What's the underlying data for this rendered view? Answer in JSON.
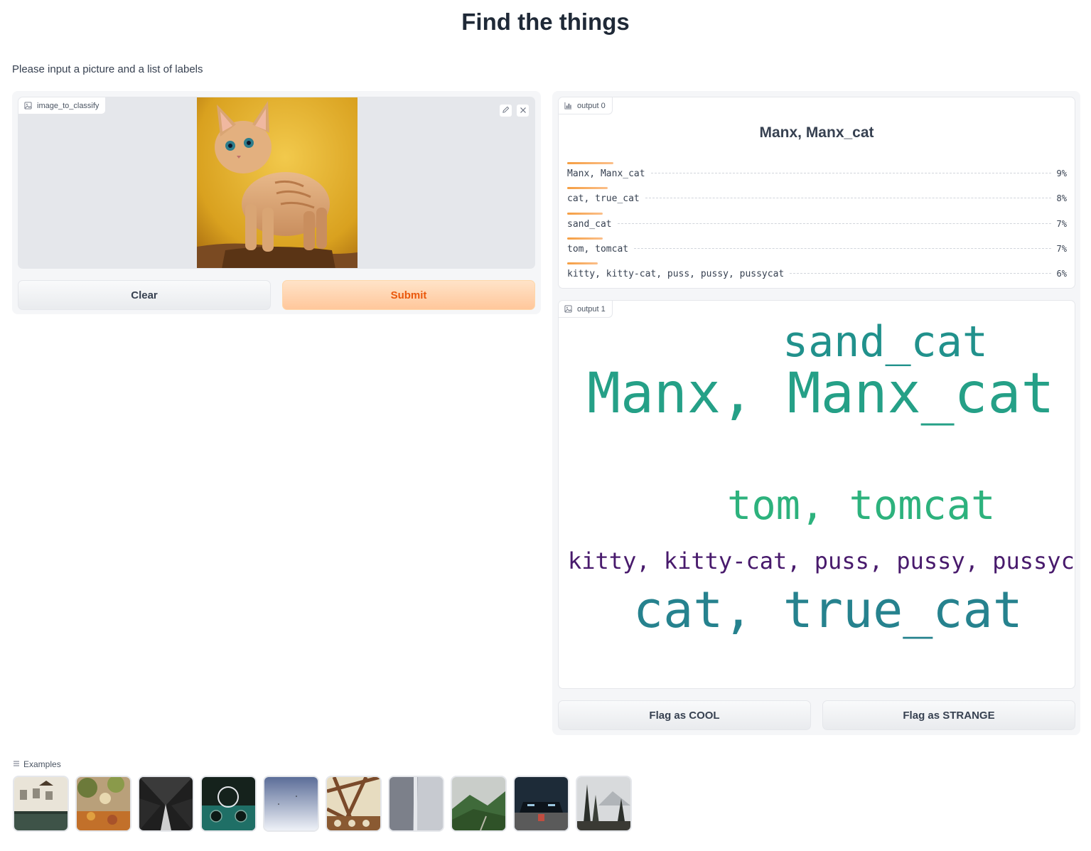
{
  "page": {
    "title": "Find the things",
    "description": "Please input a picture and a list of labels"
  },
  "input": {
    "image_label": "image_to_classify",
    "image_icon": "image-icon",
    "edit_icon": "pencil-icon",
    "close_icon": "close-icon",
    "clear_label": "Clear",
    "submit_label": "Submit"
  },
  "output0": {
    "label": "output 0",
    "icon": "bar-chart-icon",
    "top_label": "Manx, Manx_cat",
    "confidences": [
      {
        "label": "Manx, Manx_cat",
        "value": "9%",
        "fraction": 0.09
      },
      {
        "label": "cat, true_cat",
        "value": "8%",
        "fraction": 0.08
      },
      {
        "label": "sand_cat",
        "value": "7%",
        "fraction": 0.07
      },
      {
        "label": "tom, tomcat",
        "value": "7%",
        "fraction": 0.07
      },
      {
        "label": "kitty, kitty-cat, puss, pussy, pussycat",
        "value": "6%",
        "fraction": 0.06
      }
    ]
  },
  "output1": {
    "label": "output 1",
    "icon": "image-icon",
    "words": [
      {
        "text": "sand_cat",
        "color": "#21918c"
      },
      {
        "text": "Manx, Manx_cat",
        "color": "#25a087"
      },
      {
        "text": "tom, tomcat",
        "color": "#2db27d"
      },
      {
        "text": "kitty, kitty-cat, puss, pussy, pussycat",
        "color": "#481a6c"
      },
      {
        "text": "cat, true_cat",
        "color": "#26828e"
      }
    ]
  },
  "flags": {
    "cool_label": "Flag as COOL",
    "strange_label": "Flag as STRANGE"
  },
  "examples": {
    "label": "Examples",
    "icon": "list-icon",
    "thumbnails": [
      "image-example-1",
      "image-example-2",
      "image-example-3",
      "image-example-4",
      "image-example-5",
      "image-example-6",
      "image-example-7",
      "image-example-8",
      "image-example-9",
      "image-example-10"
    ]
  },
  "colors": {
    "accent": "#ea580c",
    "primary_button_bg": "#ffc79b",
    "confidence_bar": "#f59e42"
  }
}
